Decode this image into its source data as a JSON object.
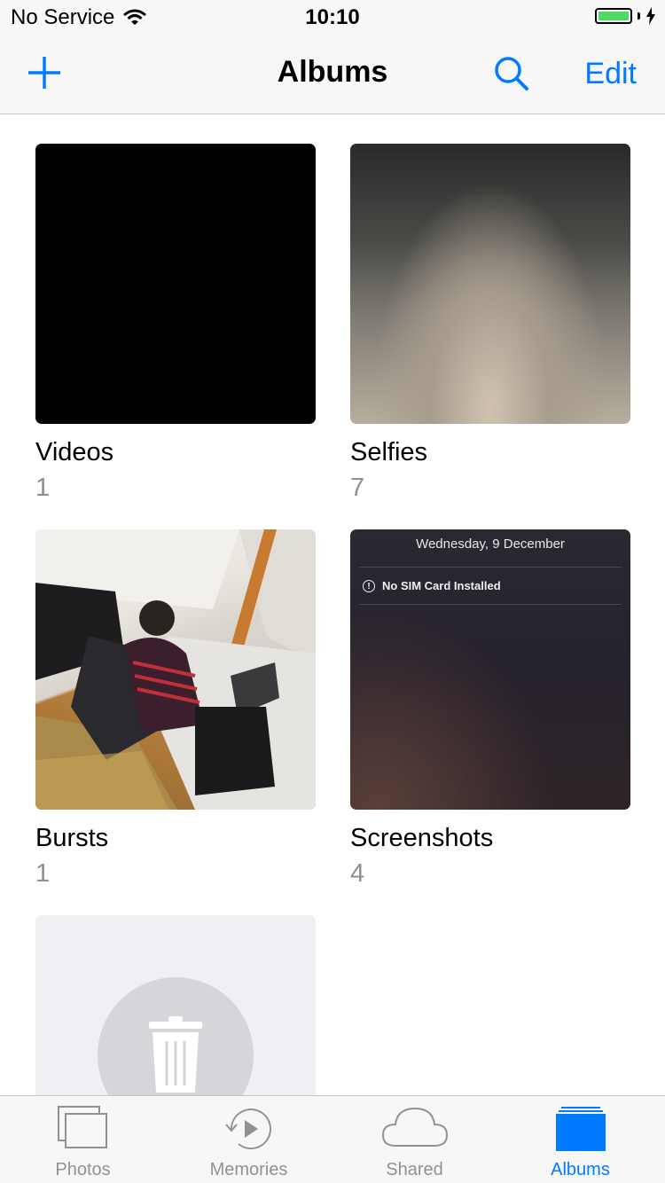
{
  "status_bar": {
    "carrier": "No Service",
    "time": "10:10",
    "battery_level": 1.0,
    "battery_color": "#4cd964"
  },
  "nav": {
    "title": "Albums",
    "edit_label": "Edit",
    "add_icon": "plus-icon",
    "search_icon": "search-icon",
    "accent_color": "#007aff"
  },
  "albums": [
    {
      "title": "Videos",
      "count": "1"
    },
    {
      "title": "Selfies",
      "count": "7"
    },
    {
      "title": "Bursts",
      "count": "1"
    },
    {
      "title": "Screenshots",
      "count": "4"
    }
  ],
  "screenshot_thumb": {
    "date": "Wednesday, 9 December",
    "alert": "No SIM Card Installed"
  },
  "tabs": [
    {
      "label": "Photos",
      "icon": "photos-icon",
      "active": false
    },
    {
      "label": "Memories",
      "icon": "memories-icon",
      "active": false
    },
    {
      "label": "Shared",
      "icon": "cloud-icon",
      "active": false
    },
    {
      "label": "Albums",
      "icon": "albums-icon",
      "active": true
    }
  ]
}
